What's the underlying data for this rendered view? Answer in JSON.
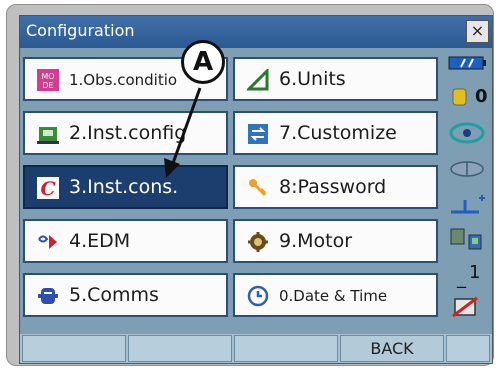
{
  "window": {
    "title": "Configuration",
    "close_label": "×"
  },
  "menu": {
    "items": [
      {
        "key": "1",
        "label": "1.Obs.conditio",
        "icon": "obs-condition-icon",
        "selected": false
      },
      {
        "key": "6",
        "label": "6.Units",
        "icon": "units-triangle-icon",
        "selected": false
      },
      {
        "key": "2",
        "label": "2.Inst.config",
        "icon": "inst-config-icon",
        "selected": false
      },
      {
        "key": "7",
        "label": "7.Customize",
        "icon": "customize-icon",
        "selected": false
      },
      {
        "key": "3",
        "label": "3.Inst.cons.",
        "icon": "inst-cons-icon",
        "selected": true
      },
      {
        "key": "8",
        "label": "8:Password",
        "icon": "key-icon",
        "selected": false
      },
      {
        "key": "4",
        "label": "4.EDM",
        "icon": "edm-icon",
        "selected": false
      },
      {
        "key": "9",
        "label": "9.Motor",
        "icon": "motor-icon",
        "selected": false
      },
      {
        "key": "5",
        "label": "5.Comms",
        "icon": "comms-icon",
        "selected": false
      },
      {
        "key": "0",
        "label": "0.Date & Time",
        "icon": "clock-icon",
        "selected": false
      }
    ]
  },
  "status": {
    "battery_icon": "battery-icon",
    "prism_constant": "0",
    "prism_icon": "prism-icon",
    "target_icon": "target-icon",
    "tilt_icon": "tilt-icon",
    "level_icon": "level-icon",
    "comm_icon": "communication-icon",
    "mode_value": "1",
    "input_icon": "input-mode-icon"
  },
  "softkeys": [
    "",
    "",
    "",
    "BACK",
    ""
  ],
  "annotation": {
    "label": "A"
  },
  "colors": {
    "titlebar": "#2c5a93",
    "selected": "#1b3e6f",
    "screen": "#7e9fb3",
    "softbar": "#a8c0cf"
  }
}
